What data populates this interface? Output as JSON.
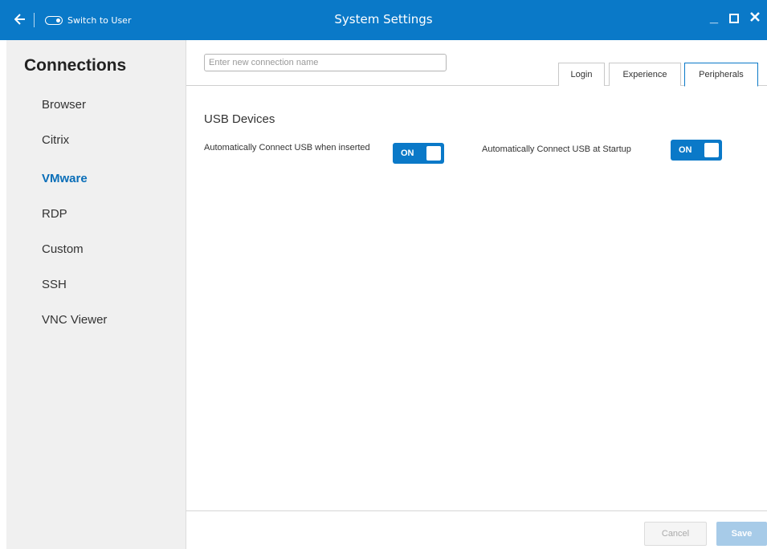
{
  "titlebar": {
    "title": "System Settings",
    "switch_user": "Switch to User",
    "bg": "#0a79c8"
  },
  "sidebar": {
    "title": "Connections",
    "items": [
      {
        "label": "Browser"
      },
      {
        "label": "Citrix"
      },
      {
        "label": "VMware",
        "active": true
      },
      {
        "label": "RDP"
      },
      {
        "label": "Custom"
      },
      {
        "label": "SSH"
      },
      {
        "label": "VNC Viewer"
      }
    ]
  },
  "main": {
    "connection_name_placeholder": "Enter new connection name",
    "tabs": [
      {
        "label": "Login"
      },
      {
        "label": "Experience"
      },
      {
        "label": "Peripherals",
        "active": true
      }
    ],
    "section_title": "USB Devices",
    "options": [
      {
        "label": "Automatically Connect USB when inserted",
        "state": "ON"
      },
      {
        "label": "Automatically Connect USB at Startup",
        "state": "ON"
      }
    ]
  },
  "footer": {
    "cancel": "Cancel",
    "save": "Save"
  }
}
